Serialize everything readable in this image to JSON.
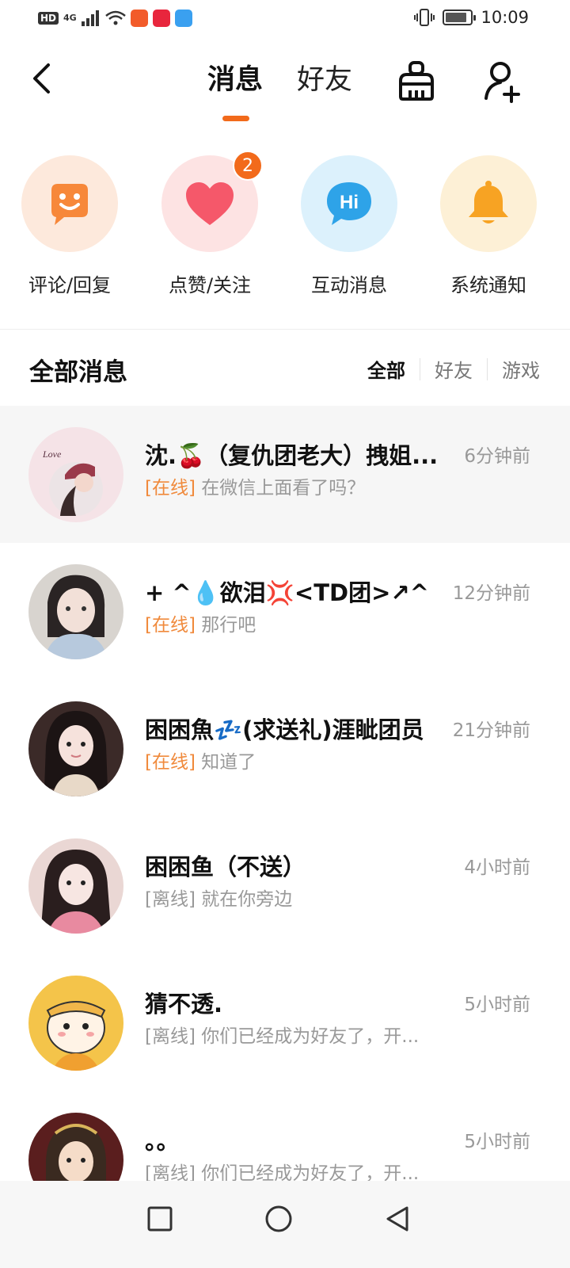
{
  "status_bar": {
    "hd": "HD",
    "network": "4G",
    "time": "10:09"
  },
  "header": {
    "tabs": [
      {
        "label": "消息",
        "active": true
      },
      {
        "label": "好友",
        "active": false
      }
    ],
    "back_icon": "chevron-left-icon",
    "clean_icon": "broom-icon",
    "add_friend_icon": "add-user-icon"
  },
  "categories": [
    {
      "label": "评论/回复",
      "icon": "smile-chat-icon",
      "bg": "#fde9dc",
      "color": "#f7883a"
    },
    {
      "label": "点赞/关注",
      "icon": "heart-icon",
      "bg": "#fde3e3",
      "color": "#f5586a",
      "badge": "2"
    },
    {
      "label": "互动消息",
      "icon": "hi-bubble-icon",
      "bg": "#dcf1fc",
      "color": "#2ea3e8"
    },
    {
      "label": "系统通知",
      "icon": "bell-icon",
      "bg": "#fdf0d6",
      "color": "#f7a323"
    }
  ],
  "section": {
    "title": "全部消息",
    "filters": [
      {
        "label": "全部",
        "active": true
      },
      {
        "label": "好友",
        "active": false
      },
      {
        "label": "游戏",
        "active": false
      }
    ]
  },
  "conversations": [
    {
      "name": "沈.🍒（复仇团老大）拽姐...",
      "time": "6分钟前",
      "status": "[在线]",
      "online": true,
      "preview": "在微信上面看了吗？"
    },
    {
      "name": "+ ^💧欲泪💢<TD团>↗^",
      "time": "12分钟前",
      "status": "[在线]",
      "online": true,
      "preview": "那行吧"
    },
    {
      "name": "困困魚💤(求送礼)涯眦团员",
      "time": "21分钟前",
      "status": "[在线]",
      "online": true,
      "preview": "知道了"
    },
    {
      "name": "困困鱼（不送）",
      "time": "4小时前",
      "status": "[离线]",
      "online": false,
      "preview": "就在你旁边"
    },
    {
      "name": "猜不透.",
      "time": "5小时前",
      "status": "[离线]",
      "online": false,
      "preview": "你们已经成为好友了，开..."
    },
    {
      "name": "。。",
      "time": "5小时前",
      "status": "[离线]",
      "online": false,
      "preview": "你们已经成为好友了，开..."
    }
  ],
  "navbar": {
    "recent_icon": "square-icon",
    "home_icon": "circle-icon",
    "back_icon": "triangle-back-icon"
  }
}
